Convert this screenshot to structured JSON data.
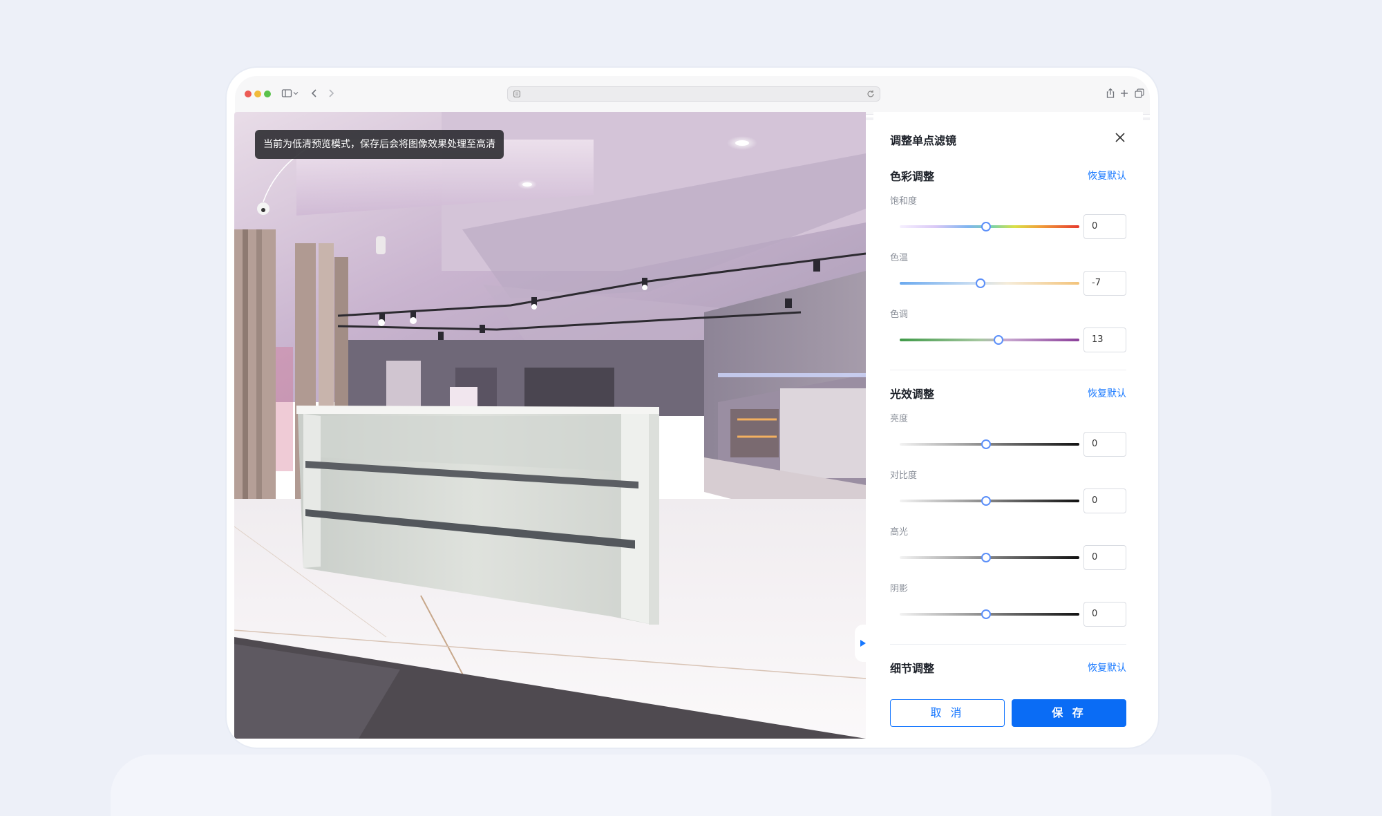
{
  "viewer": {
    "notice": "当前为低清预览模式，保存后会将图像效果处理至高清"
  },
  "panel": {
    "title": "调整单点滤镜",
    "sections": [
      {
        "title": "色彩调整",
        "reset": "恢复默认",
        "fields": [
          {
            "label": "饱和度",
            "value": "0",
            "level": 0.48
          },
          {
            "label": "色温",
            "value": "-7",
            "level": 0.45
          },
          {
            "label": "色调",
            "value": "13",
            "level": 0.55
          }
        ]
      },
      {
        "title": "光效调整",
        "reset": "恢复默认",
        "fields": [
          {
            "label": "亮度",
            "value": "0",
            "level": 0.48
          },
          {
            "label": "对比度",
            "value": "0",
            "level": 0.48
          },
          {
            "label": "高光",
            "value": "0",
            "level": 0.48
          },
          {
            "label": "阴影",
            "value": "0",
            "level": 0.48
          }
        ]
      },
      {
        "title": "细节调整",
        "reset": "恢复默认"
      }
    ],
    "cancel": "取 消",
    "save": "保 存"
  },
  "colors": {
    "accent": "#1677ff",
    "primary_button": "#0a6cf5",
    "thumb_border": "#5b8ff9"
  }
}
